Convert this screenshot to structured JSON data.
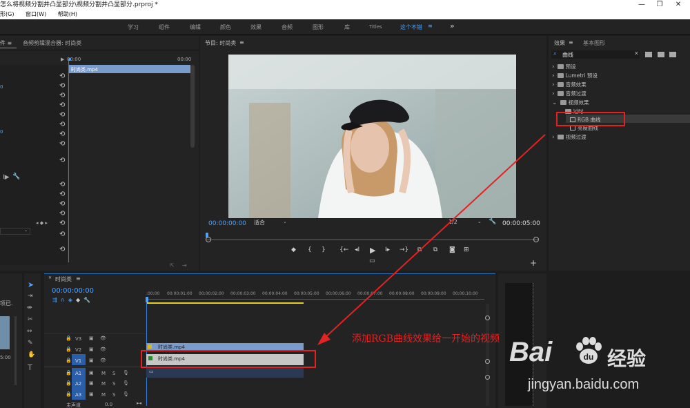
{
  "window": {
    "title": "怎么将视频分割并凸显部分\\视频分割并凸显部分.prproj *",
    "controls": [
      "—",
      "❐",
      "✕"
    ]
  },
  "menu": [
    "形(G)",
    "窗口(W)",
    "帮助(H)"
  ],
  "workspaces": [
    {
      "label": "学习",
      "active": false
    },
    {
      "label": "组件",
      "active": false
    },
    {
      "label": "编辑",
      "active": false
    },
    {
      "label": "颜色",
      "active": false
    },
    {
      "label": "效果",
      "active": false
    },
    {
      "label": "音频",
      "active": false
    },
    {
      "label": "图形",
      "active": false
    },
    {
      "label": "库",
      "active": false
    },
    {
      "label": "Titles",
      "active": false
    },
    {
      "label": "这个不错",
      "active": true
    }
  ],
  "workspace_menu_icon": "≡",
  "workspace_more": "»",
  "effect_controls": {
    "tab_fragment": "件 ≡",
    "mixer_tab": "音频剪辑混合器: 时尚类",
    "time_start": "00:00",
    "time_end": "00:00",
    "clip_name": "时尚类.mp4",
    "value_a": "0",
    "value_b": "0"
  },
  "program_monitor": {
    "title": "节目: 时尚类",
    "menu_icon": "≡",
    "timecode": "00:00:00:00",
    "fit": "适合",
    "quality": "1/2",
    "duration": "00:00:05:00"
  },
  "effects_panel": {
    "tab_effects": "效果",
    "tab_graphics": "基本图形",
    "menu_icon": "≡",
    "search_value": "曲线",
    "tree": [
      {
        "label": "预设",
        "level": 0,
        "kind": "folder",
        "expanded": false
      },
      {
        "label": "Lumetri 预设",
        "level": 0,
        "kind": "folder",
        "expanded": false
      },
      {
        "label": "音频效果",
        "level": 0,
        "kind": "folder",
        "expanded": false
      },
      {
        "label": "音频过渡",
        "level": 0,
        "kind": "folder",
        "expanded": false
      },
      {
        "label": "视频效果",
        "level": 0,
        "kind": "folder",
        "expanded": true
      },
      {
        "label": "过时",
        "level": 1,
        "kind": "folder",
        "expanded": true
      },
      {
        "label": "RGB 曲线",
        "level": 2,
        "kind": "effect",
        "selected": true
      },
      {
        "label": "亮度曲线",
        "level": 2,
        "kind": "effect"
      },
      {
        "label": "视频过渡",
        "level": 0,
        "kind": "folder",
        "expanded": false
      }
    ]
  },
  "project_panel": {
    "fragment_text": "项已.",
    "fragment_time": "5:00"
  },
  "timeline": {
    "title": "时尚类",
    "menu_icon": "≡",
    "timecode": "00:00:00:00",
    "ruler": [
      ":00:00",
      "00:00:01:00",
      "00:00:02:00",
      "00:00:03:00",
      "00:00:04:00",
      "00:00:05:00",
      "00:00:06:00",
      "00:00:07:00",
      "00:00:08:00",
      "00:00:09:00",
      "00:00:10:00"
    ],
    "video_tracks": [
      "V3",
      "V2",
      "V1"
    ],
    "audio_tracks": [
      "A1",
      "A2",
      "A3"
    ],
    "master": "主声道",
    "master_value": "0.0",
    "clip_v2": "时尚类.mp4",
    "clip_v1": "时尚类.mp4",
    "track_m": "M",
    "track_s": "S"
  },
  "annotation": {
    "text": "添加RGB曲线效果给一开始的视频",
    "color": "#e32222"
  },
  "watermark": {
    "brand_text": "Bai",
    "brand_text2": "经验",
    "url": "jingyan.baidu.com"
  },
  "colors": {
    "accent_blue": "#4ba3ff",
    "playhead_blue": "#2f7fe0",
    "work_area_yellow": "#e6d21e",
    "clip_blue": "#7a9ccc",
    "annotation_red": "#e32222"
  }
}
